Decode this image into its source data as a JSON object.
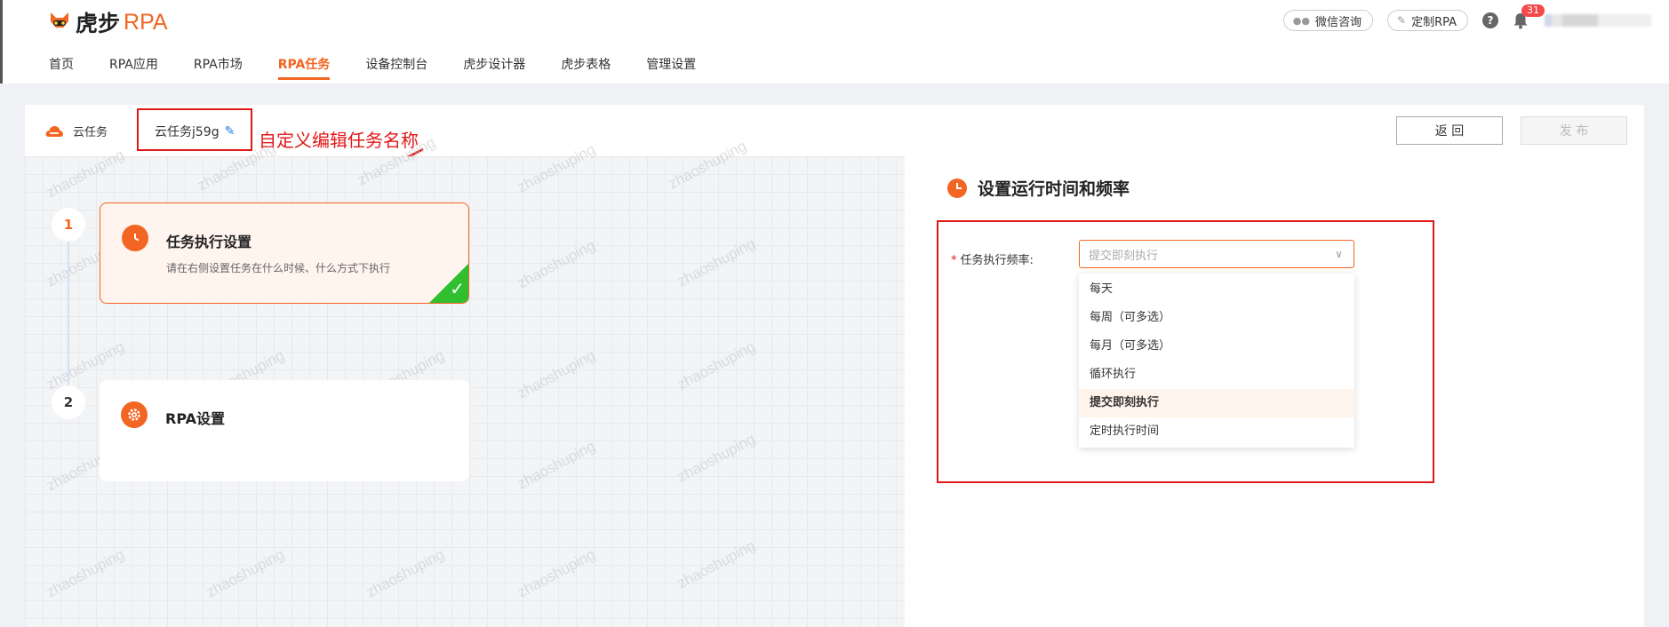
{
  "app": {
    "logo_cn": "虎步",
    "logo_en": "RPA"
  },
  "nav": {
    "items": [
      {
        "label": "首页",
        "active": false
      },
      {
        "label": "RPA应用",
        "active": false
      },
      {
        "label": "RPA市场",
        "active": false
      },
      {
        "label": "RPA任务",
        "active": true
      },
      {
        "label": "设备控制台",
        "active": false
      },
      {
        "label": "虎步设计器",
        "active": false
      },
      {
        "label": "虎步表格",
        "active": false
      },
      {
        "label": "管理设置",
        "active": false
      }
    ]
  },
  "top_right": {
    "wechat_label": "微信咨询",
    "custom_rpa_label": "定制RPA",
    "help_glyph": "?",
    "notification_count": "31"
  },
  "subbar": {
    "cloud_label": "云任务",
    "task_name": "云任务j59g",
    "annotation": "自定义编辑任务名称",
    "return_label": "返 回",
    "publish_label": "发 布"
  },
  "watermark_text": "zhaoshuping",
  "steps": [
    {
      "number": "1",
      "title": "任务执行设置",
      "desc": "请在右侧设置任务在什么时候、什么方式下执行",
      "active": true,
      "completed": true
    },
    {
      "number": "2",
      "title": "RPA设置",
      "desc": "",
      "active": false,
      "completed": false
    }
  ],
  "panel": {
    "title": "设置运行时间和频率",
    "frequency_label": "任务执行频率:",
    "required_mark": "*",
    "select_placeholder": "提交即刻执行",
    "options": [
      {
        "label": "每天",
        "selected": false
      },
      {
        "label": "每周（可多选）",
        "selected": false
      },
      {
        "label": "每月（可多选）",
        "selected": false
      },
      {
        "label": "循环执行",
        "selected": false
      },
      {
        "label": "提交即刻执行",
        "selected": true
      },
      {
        "label": "定时执行时间",
        "selected": false
      }
    ]
  },
  "colors": {
    "brand": "#f26522",
    "annotation": "#e21818",
    "check": "#2fbf2f"
  }
}
